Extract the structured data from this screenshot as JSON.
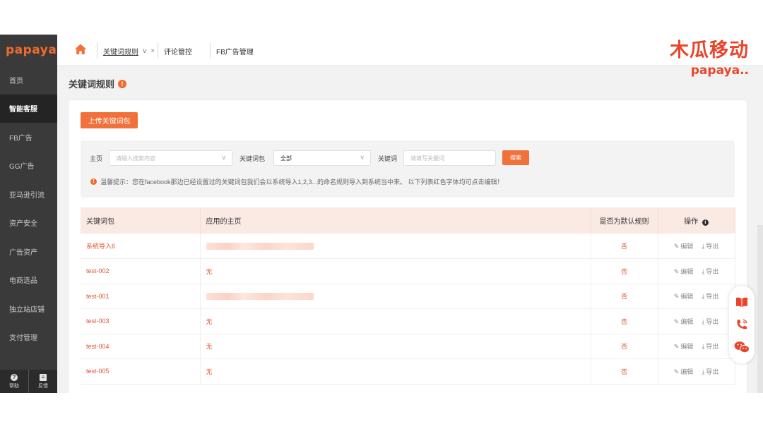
{
  "sidebar": {
    "logo": "papaya",
    "items": [
      {
        "label": "首页"
      },
      {
        "label": "智能客服"
      },
      {
        "label": "FB广告"
      },
      {
        "label": "GG广告"
      },
      {
        "label": "亚马逊引流"
      },
      {
        "label": "资产安全"
      },
      {
        "label": "广告资产"
      },
      {
        "label": "电商选品"
      },
      {
        "label": "独立站店铺"
      },
      {
        "label": "支付管理"
      }
    ],
    "active_index": 1,
    "footer": {
      "help": "帮助",
      "feedback": "反馈"
    }
  },
  "topbar": {
    "tabs": [
      {
        "label": "关键词规则",
        "chevron": "∨",
        "close": "×"
      },
      {
        "label": "评论管控"
      },
      {
        "label": "FB广告管理"
      }
    ],
    "brand_cn": "木瓜移动",
    "brand_en": "papaya.."
  },
  "page": {
    "title": "关键词规则"
  },
  "toolbar": {
    "upload_label": "上传关键词包"
  },
  "filter": {
    "page_label": "主页",
    "page_placeholder": "请输入搜索内容",
    "package_label": "关键词包",
    "package_value": "全部",
    "keyword_label": "关键词",
    "keyword_placeholder": "请填写关键词",
    "search_label": "搜索",
    "tip": "温馨提示：您在facebook那边已经设置过的关键词包我们会以系统导入1,2,3...的命名规则导入到系统当中来。 以下列表红色字体均可点击编辑！"
  },
  "table": {
    "headers": [
      "关键词包",
      "应用的主页",
      "是否为默认规则",
      "操作"
    ],
    "edit_label": "编辑",
    "export_label": "导出",
    "rows": [
      {
        "package": "系统导入6",
        "page": "",
        "page_blurred": true,
        "default": "否"
      },
      {
        "package": "test-002",
        "page": "无",
        "page_blurred": false,
        "default": "否"
      },
      {
        "package": "test-001",
        "page": "",
        "page_blurred": true,
        "default": "否"
      },
      {
        "package": "test-003",
        "page": "无",
        "page_blurred": false,
        "default": "否"
      },
      {
        "package": "test-004",
        "page": "无",
        "page_blurred": false,
        "default": "否"
      },
      {
        "package": "test-005",
        "page": "无",
        "page_blurred": false,
        "default": "否"
      }
    ]
  },
  "colors": {
    "accent": "#f0713a",
    "sidebar_bg": "#3a3a3a",
    "brand": "#e8452b",
    "header_row": "#fbe9e4"
  }
}
